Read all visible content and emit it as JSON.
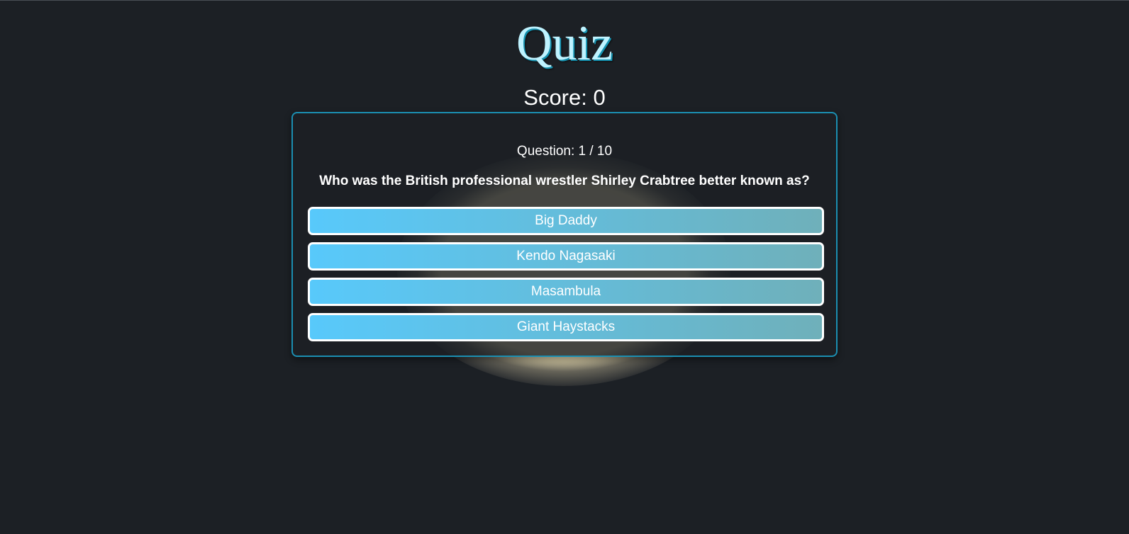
{
  "header": {
    "title": "Quiz",
    "score_text": "Score: 0"
  },
  "quiz": {
    "question_counter": "Question: 1 / 10",
    "question": "Who was the British professional wrestler Shirley Crabtree better known as?",
    "answers": [
      {
        "label": "Big Daddy"
      },
      {
        "label": "Kendo Nagasaki"
      },
      {
        "label": "Masambula"
      },
      {
        "label": "Giant Haystacks"
      }
    ]
  },
  "colors": {
    "background": "#1c2025",
    "title": "#bff3ff",
    "card_border": "#1b8fb2",
    "answer_gradient_start": "#58c9fb",
    "answer_gradient_end": "#6fb0ba",
    "answer_border": "#ffffff",
    "text": "#ffffff"
  }
}
